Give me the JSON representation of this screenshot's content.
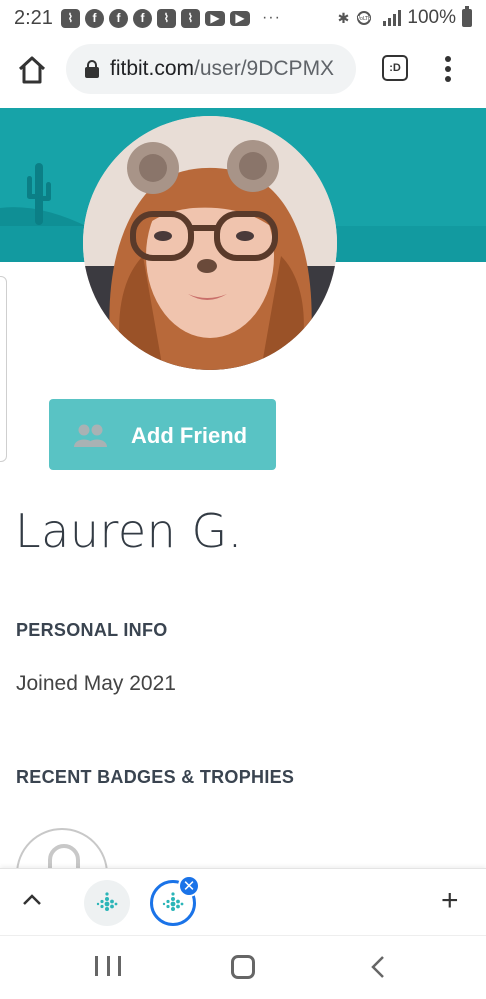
{
  "status_bar": {
    "time": "2:21",
    "battery": "100%",
    "more_indicator": "···",
    "notification_icons": [
      "nextdoor-icon",
      "facebook-icon",
      "facebook-icon",
      "facebook-icon",
      "nextdoor-icon",
      "nextdoor-icon",
      "youtube-icon",
      "youtube-icon"
    ],
    "system_icons": [
      "bluetooth-icon",
      "volte-icon",
      "lte-signal-icon",
      "battery-icon"
    ]
  },
  "browser": {
    "url_domain": "fitbit.com",
    "url_path": "/user/9DCPMX",
    "tabs_button_label": ":D"
  },
  "profile": {
    "name": "Lauren G.",
    "add_friend_label": "Add Friend",
    "personal_info_heading": "PERSONAL INFO",
    "joined": "Joined May 2021",
    "badges_heading": "RECENT BADGES & TROPHIES"
  },
  "tab_strip": {
    "open_tabs": [
      "fitbit-icon",
      "fitbit-icon"
    ],
    "active_tab": 1
  },
  "colors": {
    "banner_teal": "#17a3a8",
    "button_teal": "#59c3c4",
    "chrome_blue": "#1a73e8",
    "heading_text": "#3a4450"
  }
}
